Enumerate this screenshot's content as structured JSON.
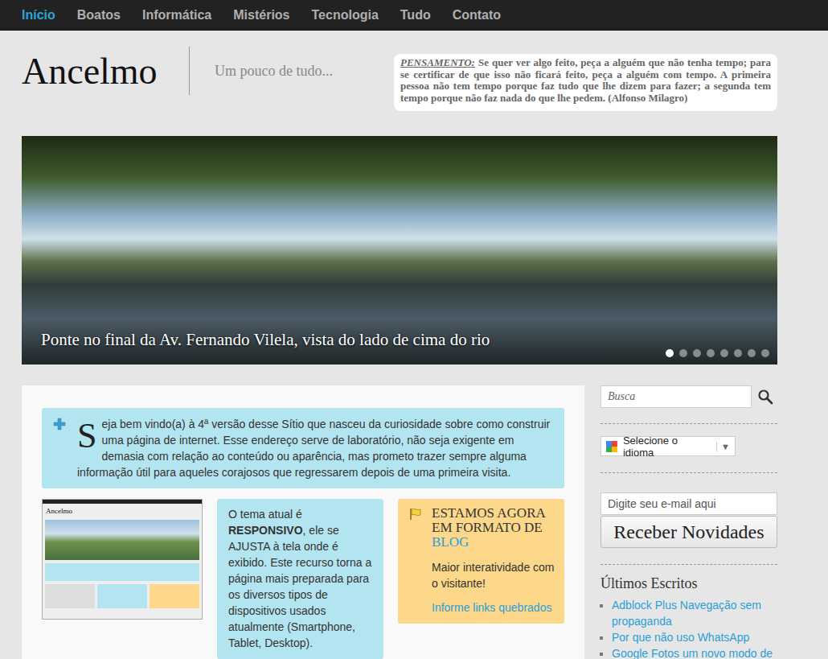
{
  "nav": {
    "items": [
      {
        "label": "Início",
        "selected": true
      },
      {
        "label": "Boatos",
        "selected": false
      },
      {
        "label": "Informática",
        "selected": false
      },
      {
        "label": "Mistérios",
        "selected": false
      },
      {
        "label": "Tecnologia",
        "selected": false
      },
      {
        "label": "Tudo",
        "selected": false
      },
      {
        "label": "Contato",
        "selected": false
      }
    ]
  },
  "header": {
    "logo": "Ancelmo",
    "tagline": "Um pouco de tudo...",
    "thought": {
      "label": "PENSAMENTO:",
      "text": "Se quer ver algo feito, peça a alguém que não tenha tempo; para se certificar de que isso não ficará feito, peça a alguém com tempo. A primeira pessoa não tem tempo porque faz tudo que lhe dizem para fazer; a segunda tem tempo porque não faz nada do que lhe pedem. (Alfonso Milagro)"
    }
  },
  "slider": {
    "caption": "Ponte no final da Av. Fernando Vilela, vista do lado de cima do rio",
    "dots": [
      {
        "selected": true
      },
      {
        "selected": false
      },
      {
        "selected": false
      },
      {
        "selected": false
      },
      {
        "selected": false
      },
      {
        "selected": false
      },
      {
        "selected": false
      },
      {
        "selected": false
      }
    ]
  },
  "welcome": {
    "drop_cap": "S",
    "text": "eja bem vindo(a) à 4ª versão desse Sítio que nasceu da curiosidade sobre como construir uma página de internet. Esse endereço serve de laboratório, não seja exigente em demasia com relação ao conteúdo ou aparência, mas prometo trazer sempre alguma informação útil para aqueles corajosos que regressarem depois de uma primeira visita."
  },
  "thumbnail": {
    "title": "Ancelmo"
  },
  "responsive": {
    "segments": [
      {
        "text": "O tema atual é ",
        "bold": false
      },
      {
        "text": "RESPONSIVO",
        "bold": true
      },
      {
        "text": ", ele se AJUSTA à tela onde é exibido. Este recurso torna a página mais preparada para os diversos tipos de dispositivos usados atualmente (Smartphone, Tablet, Desktop).",
        "bold": false
      }
    ]
  },
  "blog": {
    "title": "ESTAMOS AGORA EM FORMATO DE",
    "highlight": "BLOG",
    "text": "Maior interatividade com o visitante!",
    "link": "Informe links quebrados"
  },
  "sidebar": {
    "search": {
      "placeholder": "Busca"
    },
    "translate": {
      "label": "Selecione o idioma",
      "arrow": "▼"
    },
    "email": {
      "placeholder": "Digite seu e-mail aqui"
    },
    "button": "Receber Novidades",
    "recent": {
      "title": "Últimos Escritos",
      "items": [
        "Adblock Plus Navegação sem propaganda",
        "Por que não uso WhatsApp",
        "Google Fotos um novo modo de"
      ]
    }
  }
}
